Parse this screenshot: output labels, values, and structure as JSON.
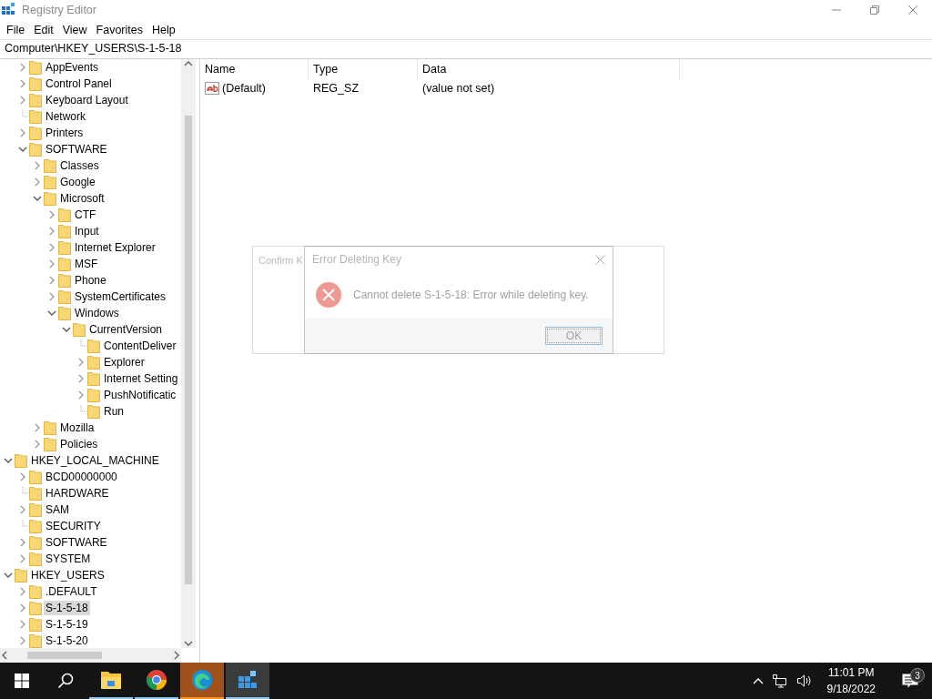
{
  "window": {
    "title": "Registry Editor"
  },
  "menu": [
    "File",
    "Edit",
    "View",
    "Favorites",
    "Help"
  ],
  "address": "Computer\\HKEY_USERS\\S-1-5-18",
  "tree": [
    {
      "children": [
        {
          "label": "AppEvents",
          "expanded": false,
          "selected": false
        },
        {
          "label": "Control Panel",
          "expanded": false,
          "selected": false
        },
        {
          "label": "Keyboard Layout",
          "expanded": false,
          "selected": false
        },
        {
          "label": "Network",
          "selected": false
        },
        {
          "label": "Printers",
          "expanded": false,
          "selected": false
        },
        {
          "label": "SOFTWARE",
          "expanded": true,
          "selected": false,
          "children": [
            {
              "label": "Classes",
              "expanded": false,
              "selected": false
            },
            {
              "label": "Google",
              "expanded": false,
              "selected": false
            },
            {
              "label": "Microsoft",
              "expanded": true,
              "selected": false,
              "children": [
                {
                  "label": "CTF",
                  "expanded": false,
                  "selected": false
                },
                {
                  "label": "Input",
                  "expanded": false,
                  "selected": false
                },
                {
                  "label": "Internet Explorer",
                  "expanded": false,
                  "selected": false
                },
                {
                  "label": "MSF",
                  "expanded": false,
                  "selected": false
                },
                {
                  "label": "Phone",
                  "expanded": false,
                  "selected": false
                },
                {
                  "label": "SystemCertificates",
                  "expanded": false,
                  "selected": false
                },
                {
                  "label": "Windows",
                  "expanded": true,
                  "selected": false,
                  "children": [
                    {
                      "label": "CurrentVersion",
                      "expanded": true,
                      "selected": false,
                      "children": [
                        {
                          "label": "ContentDeliver",
                          "selected": false
                        },
                        {
                          "label": "Explorer",
                          "expanded": false,
                          "selected": false
                        },
                        {
                          "label": "Internet Setting",
                          "expanded": false,
                          "selected": false
                        },
                        {
                          "label": "PushNotificatic",
                          "expanded": false,
                          "selected": false
                        },
                        {
                          "label": "Run",
                          "selected": false
                        }
                      ]
                    }
                  ]
                }
              ]
            },
            {
              "label": "Mozilla",
              "expanded": false,
              "selected": false
            },
            {
              "label": "Policies",
              "expanded": false,
              "selected": false
            }
          ]
        }
      ]
    },
    {
      "label": "HKEY_LOCAL_MACHINE",
      "expanded": true,
      "selected": false,
      "children": [
        {
          "label": "BCD00000000",
          "expanded": false,
          "selected": false
        },
        {
          "label": "HARDWARE",
          "selected": false
        },
        {
          "label": "SAM",
          "expanded": false,
          "selected": false
        },
        {
          "label": "SECURITY",
          "selected": false
        },
        {
          "label": "SOFTWARE",
          "expanded": false,
          "selected": false
        },
        {
          "label": "SYSTEM",
          "expanded": false,
          "selected": false
        }
      ]
    },
    {
      "label": "HKEY_USERS",
      "expanded": true,
      "selected": false,
      "children": [
        {
          "label": ".DEFAULT",
          "expanded": false,
          "selected": false
        },
        {
          "label": "S-1-5-18",
          "expanded": false,
          "selected": true
        },
        {
          "label": "S-1-5-19",
          "expanded": false,
          "selected": false
        },
        {
          "label": "S-1-5-20",
          "expanded": false,
          "selected": false
        }
      ]
    }
  ],
  "values": {
    "columns": [
      "Name",
      "Type",
      "Data"
    ],
    "rows": [
      {
        "name": "(Default)",
        "type": "REG_SZ",
        "data": "(value not set)"
      }
    ]
  },
  "dialogs": [
    {
      "kind": "back",
      "title": "Confirm K"
    },
    {
      "kind": "error",
      "title": "Error Deleting Key",
      "message": "Cannot delete S-1-5-18:  Error while deleting key.",
      "button": "OK"
    }
  ],
  "taskbar": {
    "apps": [
      {
        "kind": "files",
        "active": false,
        "flashing": false
      },
      {
        "kind": "chrome",
        "active": false,
        "flashing": false
      },
      {
        "kind": "edge",
        "active": false,
        "flashing": true
      },
      {
        "kind": "regedit",
        "active": true,
        "flashing": false
      }
    ],
    "time": "11:01 PM",
    "date": "9/18/2022",
    "notifications": "3"
  }
}
